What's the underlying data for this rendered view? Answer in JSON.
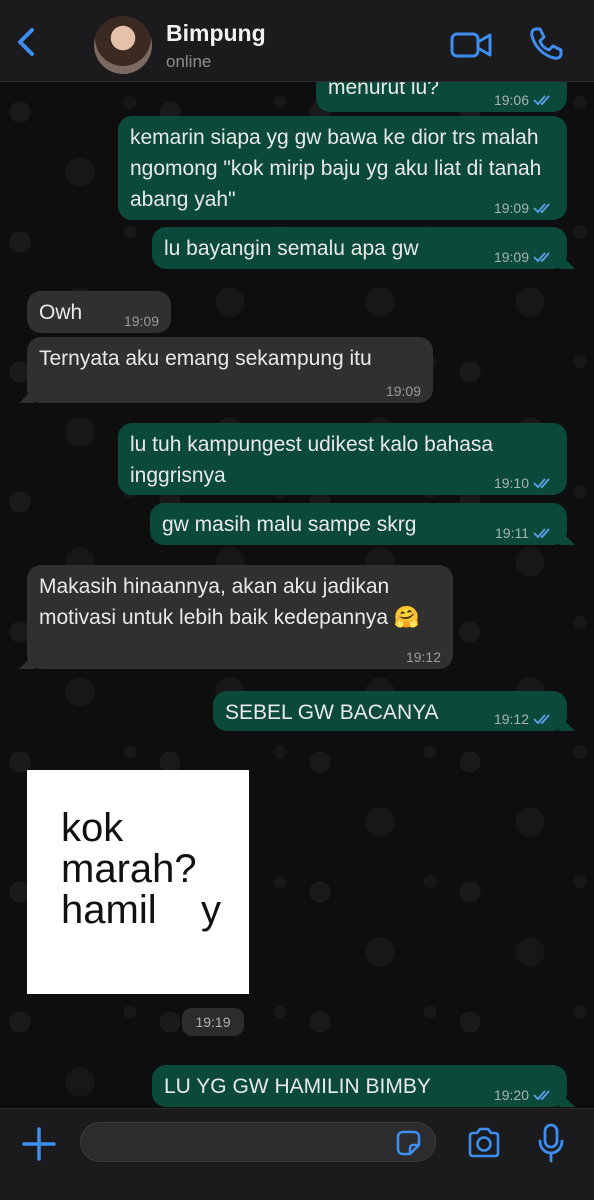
{
  "header": {
    "contact_name": "Bimpung",
    "status": "online"
  },
  "messages": [
    {
      "dir": "out",
      "text": "menurut lu?",
      "time": "19:06"
    },
    {
      "dir": "out",
      "text": "kemarin siapa yg gw bawa ke dior trs malah ngomong \"kok mirip baju yg aku liat di tanah abang yah\"",
      "time": "19:09"
    },
    {
      "dir": "out",
      "text": "lu bayangin semalu apa gw",
      "time": "19:09"
    },
    {
      "dir": "in",
      "text": "Owh",
      "time": "19:09"
    },
    {
      "dir": "in",
      "text": "Ternyata aku emang sekampung itu",
      "time": "19:09"
    },
    {
      "dir": "out",
      "text": "lu tuh kampungest udikest kalo bahasa inggrisnya",
      "time": "19:10"
    },
    {
      "dir": "out",
      "text": "gw masih malu sampe skrg",
      "time": "19:11"
    },
    {
      "dir": "in",
      "text": "Makasih hinaannya, akan aku jadikan motivasi untuk lebih baik kedepannya 🤗",
      "time": "19:12"
    },
    {
      "dir": "out",
      "text": "SEBEL GW BACANYA",
      "time": "19:12"
    },
    {
      "dir": "out",
      "text": "LU YG GW HAMILIN BIMBY",
      "time": "19:20"
    }
  ],
  "sticker": {
    "text": "kok\nmarah?\nhamil    y",
    "time": "19:19"
  },
  "composer": {
    "value": ""
  },
  "icons": {
    "back": "chevron-left-icon",
    "video": "video-camera-icon",
    "phone": "phone-icon",
    "plus": "plus-icon",
    "sticker": "sticker-icon",
    "camera": "camera-icon",
    "mic": "microphone-icon"
  },
  "colors": {
    "accent": "#3d8ef0",
    "outgoing_bubble": "#0b4a3a",
    "incoming_bubble": "#303030",
    "read_ticks": "#5aa0e8"
  }
}
